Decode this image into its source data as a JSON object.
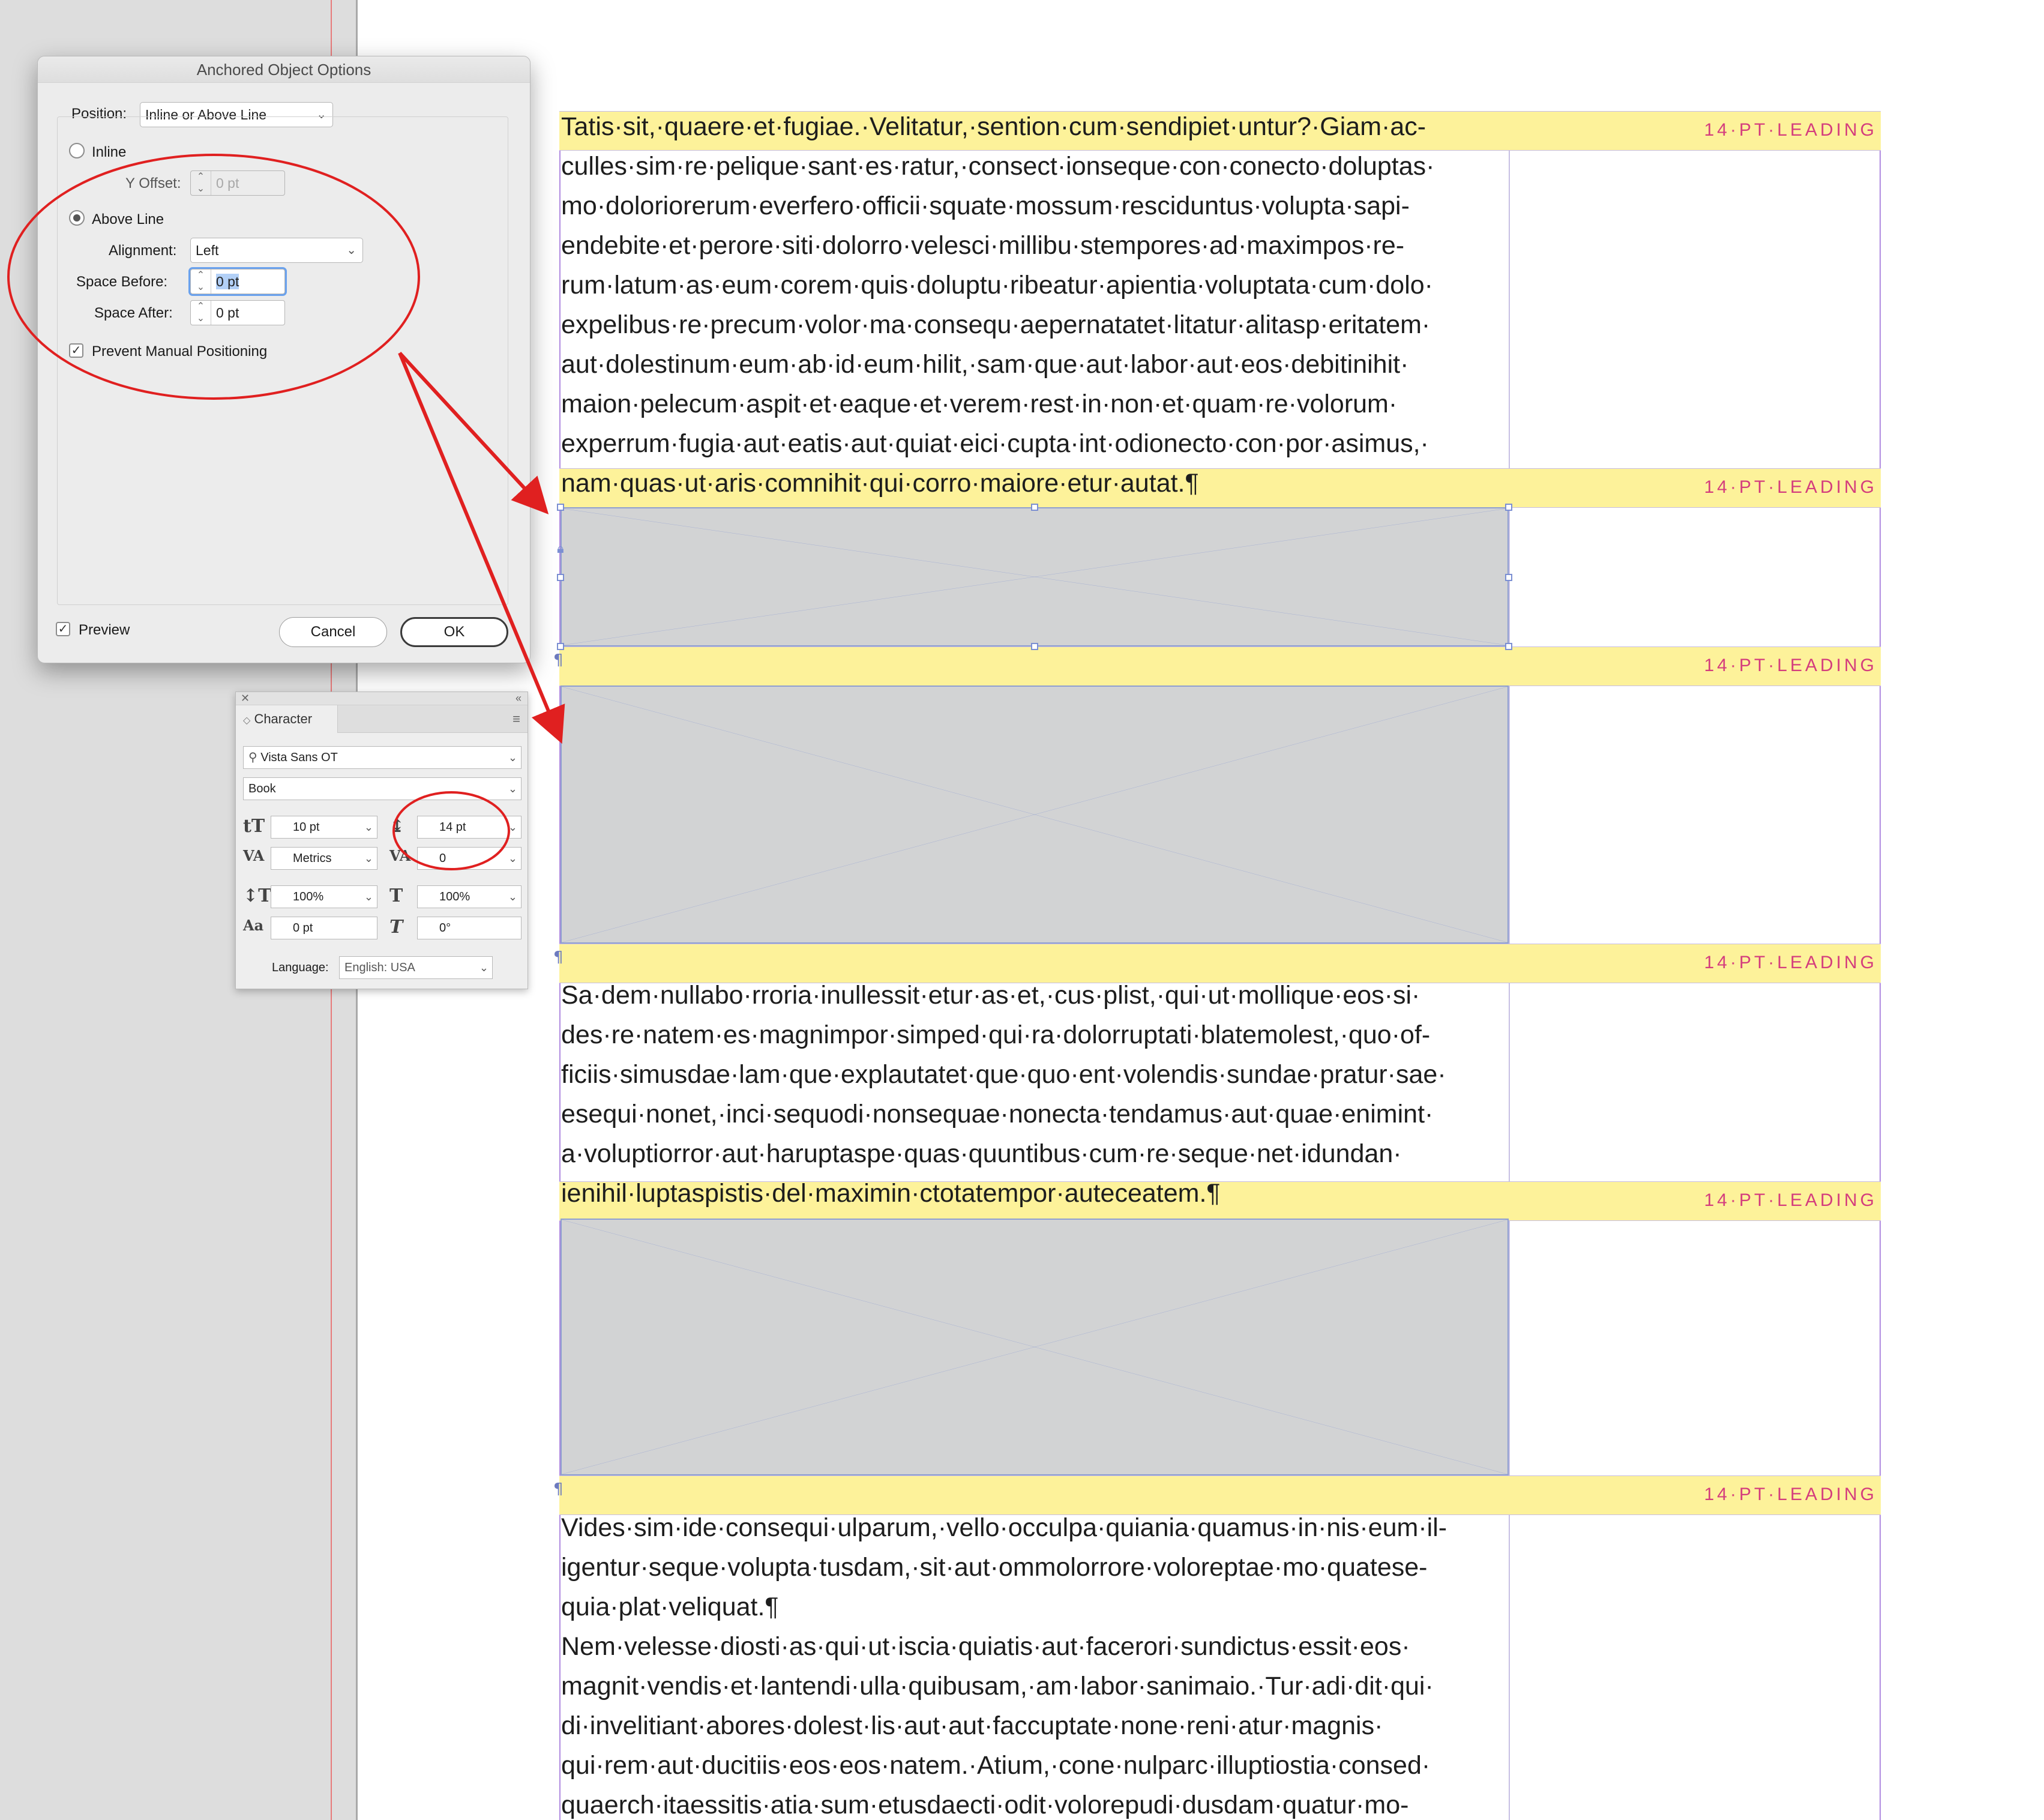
{
  "dialog": {
    "title": "Anchored Object Options",
    "position_label": "Position:",
    "position_value": "Inline or Above Line",
    "inline_label": "Inline",
    "y_offset_label": "Y Offset:",
    "y_offset_value": "0 pt",
    "above_line_label": "Above Line",
    "alignment_label": "Alignment:",
    "alignment_value": "Left",
    "space_before_label": "Space Before:",
    "space_before_value": "0 pt",
    "space_after_label": "Space After:",
    "space_after_value": "0 pt",
    "prevent_label": "Prevent Manual Positioning",
    "preview_label": "Preview",
    "cancel_label": "Cancel",
    "ok_label": "OK",
    "selected_option": "Above Line"
  },
  "character_panel": {
    "tab_label": "Character",
    "font_family": "Vista Sans OT",
    "font_style": "Book",
    "font_size": "10 pt",
    "leading": "14 pt",
    "kerning": "Metrics",
    "tracking": "0",
    "vertical_scale": "100%",
    "horizontal_scale": "100%",
    "baseline_shift": "0 pt",
    "skew": "0°",
    "language_label": "Language:",
    "language_value": "English: USA"
  },
  "document": {
    "leading_label": "14·PT·LEADING",
    "para1": [
      "Tatis·sit,·quaere·et·fugiae.·Velitatur,·sention·cum·sendipiet·untur?·Giam·ac-",
      "culles·sim·re·pelique·sant·es·ratur,·consect·ionseque·con·conecto·doluptas·",
      "mo·doloriorerum·everfero·officii·squate·mossum·resciduntus·volupta·sapi-",
      "endebite·et·perore·siti·dolorro·velesci·millibu·stempores·ad·maximpos·re-",
      "rum·latum·as·eum·corem·quis·doluptu·ribeatur·apientia·voluptata·cum·dolo·",
      "expelibus·re·precum·volor·ma·consequ·aepernatatet·litatur·alitasp·eritatem·",
      "aut·dolestinum·eum·ab·id·eum·hilit,·sam·que·aut·labor·aut·eos·debitinihit·",
      "maion·pelecum·aspit·et·eaque·et·verem·rest·in·non·et·quam·re·volorum·",
      "experrum·fugia·aut·eatis·aut·quiat·eici·cupta·int·odionecto·con·por·asimus,·",
      "nam·quas·ut·aris·comnihit·qui·corro·maiore·etur·autat.¶"
    ],
    "para2": [
      "Sa·dem·nullabo·rroria·inullessit·etur·as·et,·cus·plist,·qui·ut·mollique·eos·si·",
      "des·re·natem·es·magnimpor·simped·qui·ra·dolorruptati·blatemolest,·quo·of-",
      "ficiis·simusdae·lam·que·explautatet·que·quo·ent·volendis·sundae·pratur·sae·",
      "esequi·nonet,·inci·sequodi·nonsequae·nonecta·tendamus·aut·quae·enimint·",
      "a·voluptiorror·aut·haruptaspe·quas·quuntibus·cum·re·seque·net·idundan·",
      "ienihil·luptaspistis·del·maximin·ctotatempor·auteceatem.¶"
    ],
    "para3": [
      "Vides·sim·ide·consequi·ulparum,·vello·occulpa·quiania·quamus·in·nis·eum·il-",
      "igentur·seque·volupta·tusdam,·sit·aut·ommolorrore·voloreptae·mo·quatese-",
      "quia·plat·veliquat.¶",
      "Nem·velesse·diosti·as·qui·ut·iscia·quiatis·aut·facerori·sundictus·essit·eos·",
      "magnit·vendis·et·lantendi·ulla·quibusam,·am·labor·sanimaio.·Tur·adi·dit·qui·",
      "di·invelitiant·abores·dolest·lis·aut·aut·faccuptate·none·reni·atur·magnis·",
      "qui·rem·aut·ducitiis·eos·eos·natem.·Atium,·cone·nulparc·illuptiostia·consed·",
      "quaerch·itaessitis·atia·sum·etusdaecti·odit·volorepudi·dusdam·quatur·mo-"
    ],
    "pilcrow": "¶"
  },
  "colors": {
    "highlight": "#fdf29a",
    "leading_text": "#d43d7d",
    "annotation": "#e02020",
    "frame_guide": "#b18ce0"
  }
}
